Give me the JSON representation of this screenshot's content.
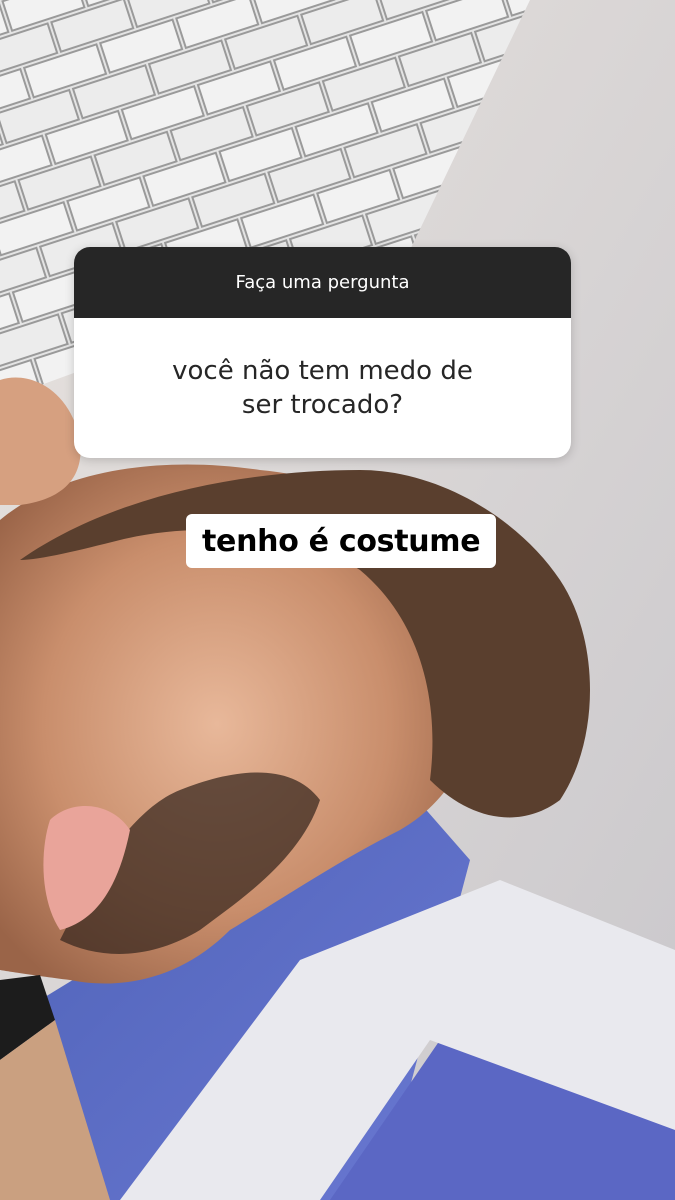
{
  "question_sticker": {
    "header": "Faça uma pergunta",
    "question": "você não tem medo de ser trocado?"
  },
  "answer_caption": "tenho é costume",
  "background_photo": "selfie",
  "colors": {
    "sticker_header_bg": "#262626",
    "sticker_body_bg": "#ffffff",
    "caption_bg": "#ffffff"
  }
}
